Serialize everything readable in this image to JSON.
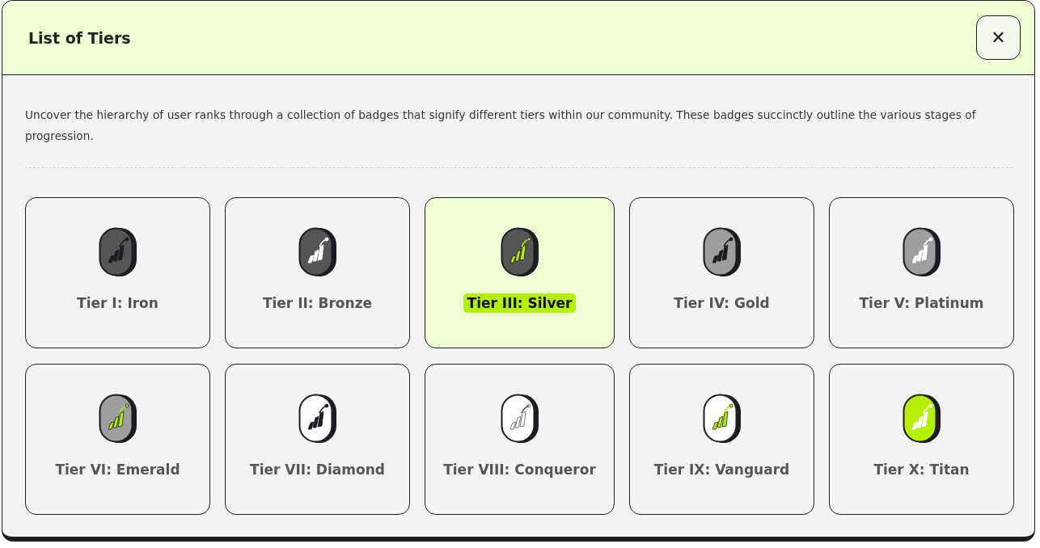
{
  "dialog": {
    "title": "List of Tiers",
    "close_label": "✕"
  },
  "description": "Uncover the hierarchy of user ranks through a collection of badges that signify different tiers within our community. These badges succinctly outline the various stages of progression.",
  "tiers": [
    {
      "label": "Tier I: Iron",
      "selected": false,
      "color": "#555555",
      "kind": "dark"
    },
    {
      "label": "Tier II: Bronze",
      "selected": false,
      "color": "#555555",
      "kind": "light"
    },
    {
      "label": "Tier III: Silver",
      "selected": true,
      "color": "#555555",
      "kind": "lime"
    },
    {
      "label": "Tier IV: Gold",
      "selected": false,
      "color": "#9e9e9e",
      "kind": "dark"
    },
    {
      "label": "Tier V: Platinum",
      "selected": false,
      "color": "#9e9e9e",
      "kind": "light"
    },
    {
      "label": "Tier VI: Emerald",
      "selected": false,
      "color": "#9e9e9e",
      "kind": "lime"
    },
    {
      "label": "Tier VII: Diamond",
      "selected": false,
      "color": "#ffffff",
      "kind": "dark"
    },
    {
      "label": "Tier VIII: Conqueror",
      "selected": false,
      "color": "#ffffff",
      "kind": "outline"
    },
    {
      "label": "Tier IX: Vanguard",
      "selected": false,
      "color": "#ffffff",
      "kind": "lime"
    },
    {
      "label": "Tier X: Titan",
      "selected": false,
      "color": "#b4f000",
      "kind": "light"
    }
  ]
}
